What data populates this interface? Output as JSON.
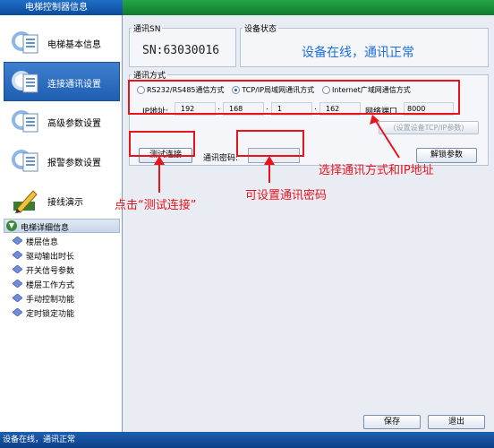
{
  "window": {
    "title": "电梯控制器信息"
  },
  "sidebar": {
    "items": [
      {
        "label": "电梯基本信息",
        "icon": "document-list-icon",
        "active": false
      },
      {
        "label": "连接通讯设置",
        "icon": "network-connection-icon",
        "active": true
      },
      {
        "label": "高级参数设置",
        "icon": "advanced-settings-icon",
        "active": false
      },
      {
        "label": "报警参数设置",
        "icon": "alarm-settings-icon",
        "active": false
      },
      {
        "label": "接线演示",
        "icon": "wiring-pencil-icon",
        "active": false
      }
    ],
    "details": {
      "header": "电梯详细信息",
      "items": [
        "楼层信息",
        "驱动输出时长",
        "开关信号参数",
        "楼层工作方式",
        "手动控制功能",
        "定时锁定功能"
      ]
    }
  },
  "sn": {
    "label": "通讯SN",
    "value": "SN:63030016"
  },
  "device_status": {
    "label": "设备状态",
    "value": "设备在线，通讯正常"
  },
  "comm": {
    "label": "通讯方式",
    "options": [
      "RS232/RS485通信方式",
      "TCP/IP局域网通讯方式",
      "Internet广域网通信方式"
    ],
    "selected": 1,
    "ip_label": "IP地址:",
    "ip": [
      "192",
      "168",
      "1",
      "162"
    ],
    "port_label": "网络端口",
    "port": "8000",
    "set_tcp_button": "(设置设备TCP/IP参数)",
    "test_button": "测试连接",
    "password_label": "通讯密码:",
    "password_value": "",
    "unlock_button": "解锁参数"
  },
  "annotations": {
    "select_comm": "选择通讯方式和IP地址",
    "click_test": "点击“测试连接”",
    "set_password": "可设置通讯密码"
  },
  "footer": {
    "save": "保存",
    "exit": "退出"
  },
  "statusbar": {
    "text": "设备在线，通讯正常"
  },
  "colors": {
    "accent": "#1e6fdc",
    "annotation": "#e8141c",
    "titlebar": "#0f2f6e",
    "highlight": "#26a546"
  }
}
